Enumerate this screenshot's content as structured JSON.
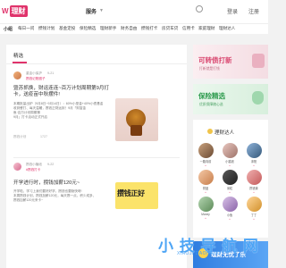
{
  "header": {
    "logo_prefix": "W",
    "logo_text": "理财",
    "nav_active": "服务",
    "right_link_1": "登录",
    "right_link_2": "注册"
  },
  "subnav": {
    "items": [
      "小组",
      "每日一问",
      "攒钱计划",
      "基金定投",
      "保险精选",
      "理财新手",
      "财务自由",
      "攒钱打卡",
      "房贷车贷",
      "信用卡",
      "家庭理财",
      "理财达人"
    ]
  },
  "main": {
    "title": "精选",
    "posts": [
      {
        "user": "重金小保护",
        "date": "9-21",
        "tag": "攒钱记账圈子",
        "title": "暨苏抓换，财运连连~百万计划周期第9月打卡，送疫苗中秋摆件!",
        "body": [
          "本期批量出炉（9月8日~9月14日）：60%小型金+40%小债基金",
          "收到餐打、每天温暖，攒钱正财运到！9月「财富金",
          "鱼·百万计划周期第",
          "9月」打卡活动正式开启"
        ],
        "meta_left": "攒钱计划",
        "meta_count": "1727"
      },
      {
        "user": "攒钱小糖纸",
        "date": "9-22",
        "tag": "#攒钱打卡",
        "title": "开学进行时，攒钱加薪120元~",
        "body": [
          "开学啦，学习上我们要好好学，攒钱也要勤快呀!",
          "本周攒钱计划，攒钱加薪120元，每天攒一点，积少成多，",
          "攒钱加薪120元来卡~"
        ],
        "meta_left": "",
        "meta_count": ""
      }
    ],
    "post2_image_text": "攒钱正好"
  },
  "sidebar": {
    "banner1_title": "可转债打新",
    "banner1_sub": "打新就是打钱",
    "banner2_title": "保险精选",
    "banner2_sub": "优质保障随心选",
    "experts_title": "理财达人",
    "experts": [
      {
        "name": "一路向前",
        "stat": "+"
      },
      {
        "name": "小猫钱",
        "stat": "+"
      },
      {
        "name": "沐阳",
        "stat": "+"
      },
      {
        "name": "财迷",
        "stat": "+"
      },
      {
        "name": "米粒",
        "stat": "+"
      },
      {
        "name": "攒钱妹",
        "stat": "+"
      },
      {
        "name": "Money",
        "stat": "+"
      },
      {
        "name": "小鱼",
        "stat": "+"
      },
      {
        "name": "丁丁",
        "stat": "+"
      }
    ],
    "banner3_title": "理财无忧了乐"
  },
  "watermark": {
    "text": "小 技 导 航 网",
    "sub": "XIAOJI DAOHANG"
  },
  "colors": {
    "accent": "#e0336b",
    "banner1_bg": "#f6e6ea",
    "banner2_bg": "#e6f4e9"
  }
}
